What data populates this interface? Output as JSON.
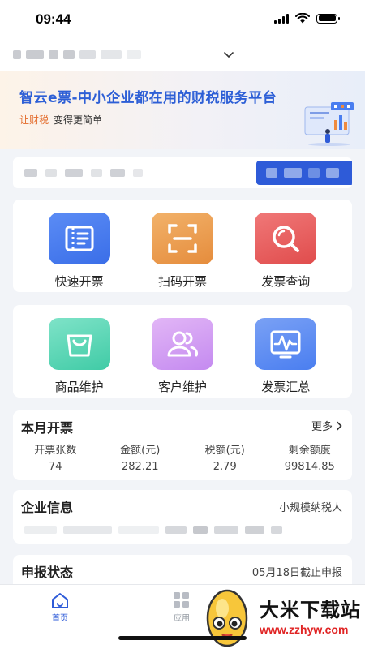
{
  "status_bar": {
    "time": "09:44"
  },
  "banner": {
    "title": "智云e票-中小企业都在用的财税服务平台",
    "sub_accent": "让财税",
    "sub_rest": "变得更简单"
  },
  "grid_row1": [
    {
      "label": "快速开票",
      "icon": "quick-invoice-icon",
      "color": "#4a7ef0"
    },
    {
      "label": "扫码开票",
      "icon": "scan-code-icon",
      "color": "#ea9a46"
    },
    {
      "label": "发票查询",
      "icon": "search-icon",
      "color": "#ea5a5a"
    }
  ],
  "grid_row2": [
    {
      "label": "商品维护",
      "icon": "bag-icon",
      "color": "#46d0ad"
    },
    {
      "label": "客户维护",
      "icon": "users-icon",
      "color": "#c48af0"
    },
    {
      "label": "发票汇总",
      "icon": "chart-monitor-icon",
      "color": "#4a7ef0"
    }
  ],
  "month": {
    "title": "本月开票",
    "more": "更多",
    "stats": [
      {
        "label": "开票张数",
        "value": "74"
      },
      {
        "label": "金额(元)",
        "value": "282.21"
      },
      {
        "label": "税额(元)",
        "value": "2.79"
      },
      {
        "label": "剩余额度",
        "value": "99814.85"
      }
    ]
  },
  "enterprise": {
    "title": "企业信息",
    "type": "小规模纳税人"
  },
  "declare": {
    "title": "申报状态",
    "deadline": "05月18日截止申报"
  },
  "tabs": [
    {
      "label": "首页",
      "active": true
    },
    {
      "label": "应用",
      "active": false
    }
  ],
  "watermark": {
    "text": "大米下载站",
    "url": "www.zzhyw.com"
  },
  "colors": {
    "primary": "#2e5bd8",
    "accent": "#e36b2b"
  }
}
